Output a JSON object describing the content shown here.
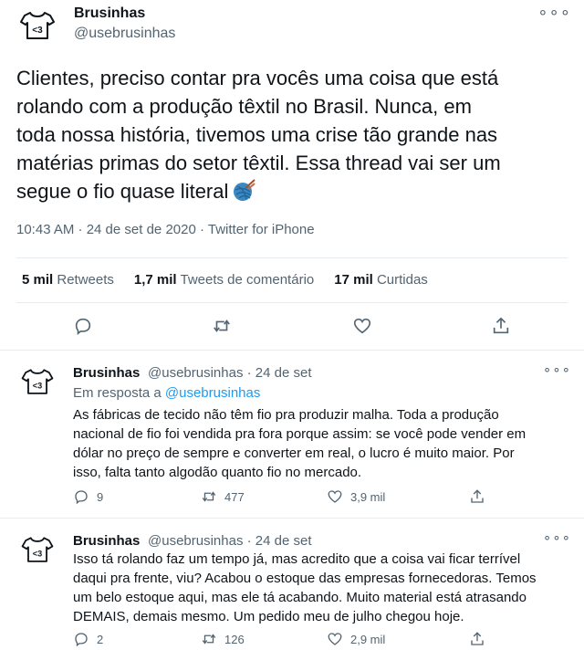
{
  "main_tweet": {
    "author_name": "Brusinhas",
    "handle": "@usebrusinhas",
    "more": "∘∘∘",
    "text_lines": [
      "Clientes, preciso contar pra vocês uma coisa que está",
      "rolando com a produção têxtil no Brasil. Nunca, em",
      "toda nossa história, tivemos uma crise tão grande nas",
      "matérias primas do setor têxtil. Essa thread vai ser um",
      "segue o fio quase literal"
    ],
    "emoji": "yarn-emoji",
    "meta": "10:43 AM · 24 de set de 2020 · Twitter for iPhone",
    "stats": {
      "retweets_count": "5 mil",
      "retweets_label": "Retweets",
      "quotes_count": "1,7 mil",
      "quotes_label": "Tweets de comentário",
      "likes_count": "17 mil",
      "likes_label": "Curtidas"
    }
  },
  "replies": [
    {
      "author_name": "Brusinhas",
      "handle_date": "@usebrusinhas · 24 de set",
      "more": "∘∘∘",
      "reply_to_prefix": "Em resposta a",
      "reply_to_mention": "@usebrusinhas",
      "text_lines": [
        "As fábricas de tecido não têm fio pra produzir malha. Toda a produção",
        "nacional de fio foi vendida pra fora porque assim: se você pode vender em",
        "dólar no preço de sempre e converter em real, o lucro é muito maior. Por",
        "isso, falta tanto algodão quanto fio no mercado."
      ],
      "reply_count": "9",
      "retweet_count": "477",
      "like_count": "3,9 mil"
    },
    {
      "author_name": "Brusinhas",
      "handle_date": "@usebrusinhas · 24 de set",
      "more": "∘∘∘",
      "text_lines": [
        "Isso tá rolando faz um tempo já, mas acredito que a coisa vai ficar terrível",
        "daqui pra frente, viu? Acabou o estoque das empresas fornecedoras. Temos",
        "um belo estoque aqui, mas ele tá acabando. Muito material está atrasando",
        "DEMAIS, demais mesmo. Um pedido meu de julho chegou hoje."
      ],
      "reply_count": "2",
      "retweet_count": "126",
      "like_count": "2,9 mil"
    }
  ],
  "colors": {
    "accent": "#1d9bf0",
    "text": "#0f1419",
    "muted": "#536471",
    "divider": "#e6ecf0"
  },
  "icons": [
    "shirt-logo-icon",
    "reply-icon",
    "retweet-icon",
    "like-icon",
    "share-icon",
    "more-icon",
    "yarn-emoji"
  ]
}
